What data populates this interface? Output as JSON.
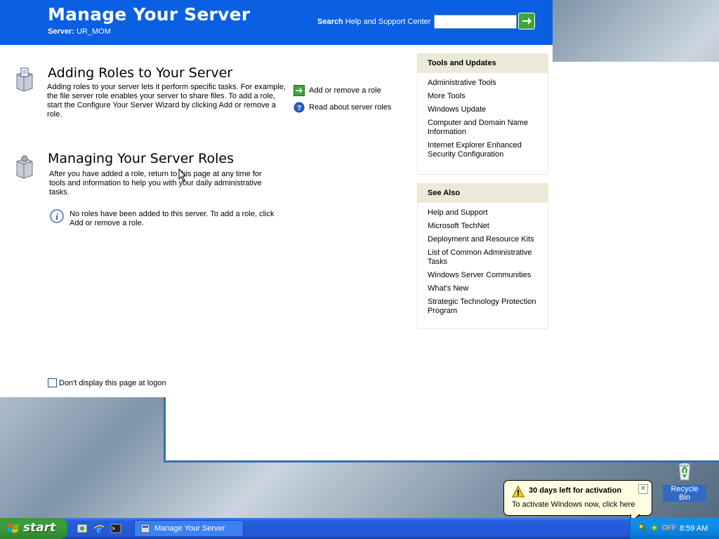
{
  "header": {
    "title": "Manage Your Server",
    "server_label": "Server:",
    "server_name": "UR_MOM",
    "search_bold": "Search",
    "search_rest": "Help and Support Center",
    "search_value": ""
  },
  "sections": {
    "adding": {
      "heading": "Adding Roles to Your Server",
      "description": "Adding roles to your server lets it perform specific tasks. For example, the file server role enables your server to share files. To add a role, start the Configure Your Server Wizard by clicking Add or remove a role.",
      "actions": [
        "Add or remove a role",
        "Read about server roles"
      ]
    },
    "managing": {
      "heading": "Managing Your Server Roles",
      "description": "After you have added a role, return to this page at any time for tools and information to help you with your daily administrative tasks.",
      "info": "No roles have been added to this server. To add a role, click Add or remove a role."
    }
  },
  "panels": {
    "tools": {
      "title": "Tools and Updates",
      "items": [
        "Administrative Tools",
        "More Tools",
        "Windows Update",
        "Computer and Domain Name Information",
        "Internet Explorer Enhanced Security Configuration"
      ]
    },
    "see_also": {
      "title": "See Also",
      "items": [
        "Help and Support",
        "Microsoft TechNet",
        "Deployment and Resource Kits",
        "List of Common Administrative Tasks",
        "Windows Server Communities",
        "What's New",
        "Strategic Technology Protection Program"
      ]
    }
  },
  "logon_checkbox": {
    "label": "Don't display this page at logon",
    "checked": false
  },
  "desktop": {
    "recycle_bin": "Recycle Bin"
  },
  "balloon": {
    "title": "30 days left for activation",
    "text": "To activate Windows now, click here",
    "close": "✕"
  },
  "taskbar": {
    "start_label": "start",
    "task_button": "Manage Your Server",
    "tray_off": "OFF",
    "clock": "8:59 AM"
  },
  "colors": {
    "header_blue": "#0a5fe2",
    "panel_header": "#ece9d8",
    "taskbar_blue": "#245edb",
    "start_green": "#3a9c3a",
    "balloon_bg": "#ffffe1"
  }
}
